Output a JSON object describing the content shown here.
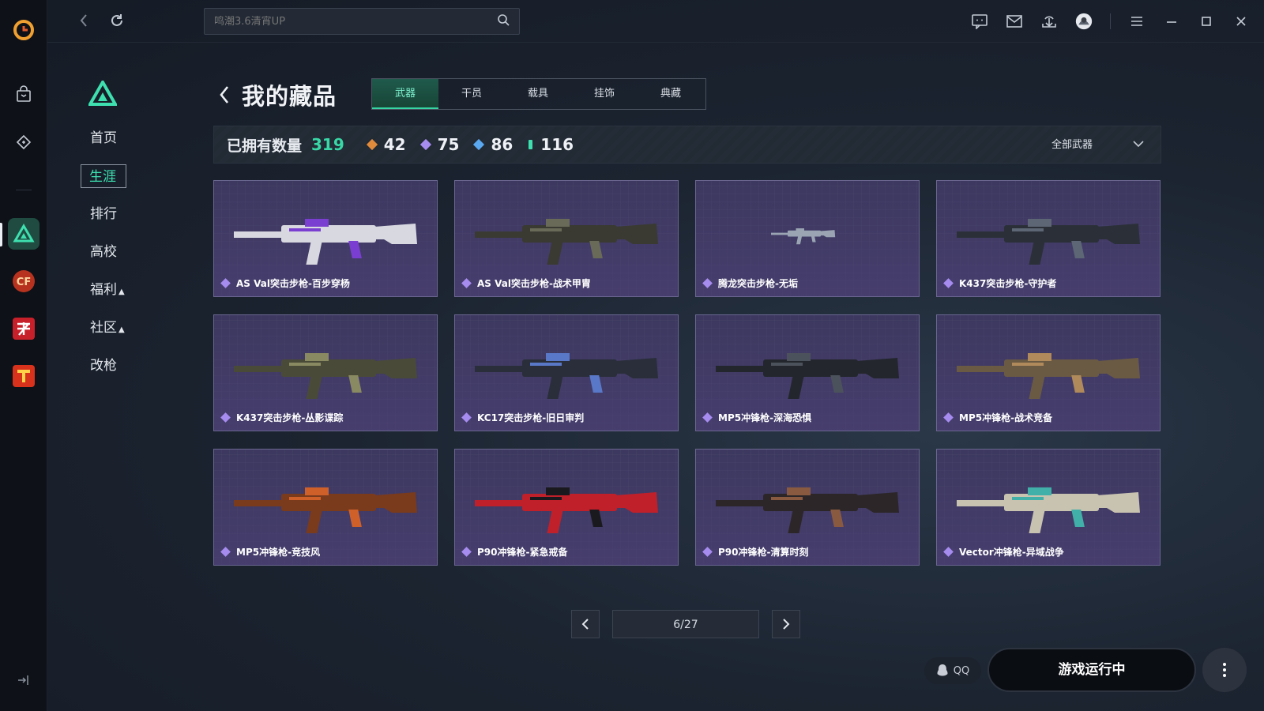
{
  "topbar": {
    "search_placeholder": "鸣潮3.6清宵UP"
  },
  "leftnav": {
    "items": [
      {
        "label": "首页"
      },
      {
        "label": "生涯"
      },
      {
        "label": "排行"
      },
      {
        "label": "高校"
      },
      {
        "label": "福利"
      },
      {
        "label": "社区"
      },
      {
        "label": "改枪"
      }
    ]
  },
  "page": {
    "title": "我的藏品",
    "tabs": [
      "武器",
      "干员",
      "载具",
      "挂饰",
      "典藏"
    ]
  },
  "stats": {
    "owned_label": "已拥有数量",
    "owned_count": "319",
    "rarities": [
      {
        "value": "42",
        "color": "#e08a3c"
      },
      {
        "value": "75",
        "color": "#a78cf0"
      },
      {
        "value": "86",
        "color": "#5aa8f0"
      },
      {
        "value": "116",
        "color": "#3ee0b0"
      }
    ],
    "filter_label": "全部武器"
  },
  "items": [
    {
      "name": "AS Val突击步枪-百步穿杨"
    },
    {
      "name": "AS Val突击步枪-战术甲胄"
    },
    {
      "name": "腾龙突击步枪-无垢"
    },
    {
      "name": "K437突击步枪-守护者"
    },
    {
      "name": "K437突击步枪-丛影谍踪"
    },
    {
      "name": "KC17突击步枪-旧日审判"
    },
    {
      "name": "MP5冲锋枪-深海恐惧"
    },
    {
      "name": "MP5冲锋枪-战术竞备"
    },
    {
      "name": "MP5冲锋枪-竞技风"
    },
    {
      "name": "P90冲锋枪-紧急戒备"
    },
    {
      "name": "P90冲锋枪-清算时刻"
    },
    {
      "name": "Vector冲锋枪-异域战争"
    }
  ],
  "pagination": {
    "page_info": "6/27"
  },
  "footer": {
    "qq_label": "QQ",
    "run_label": "游戏运行中"
  },
  "colors": {
    "accent": "#3ee0b0",
    "card_bg": "#3c3a5f"
  }
}
